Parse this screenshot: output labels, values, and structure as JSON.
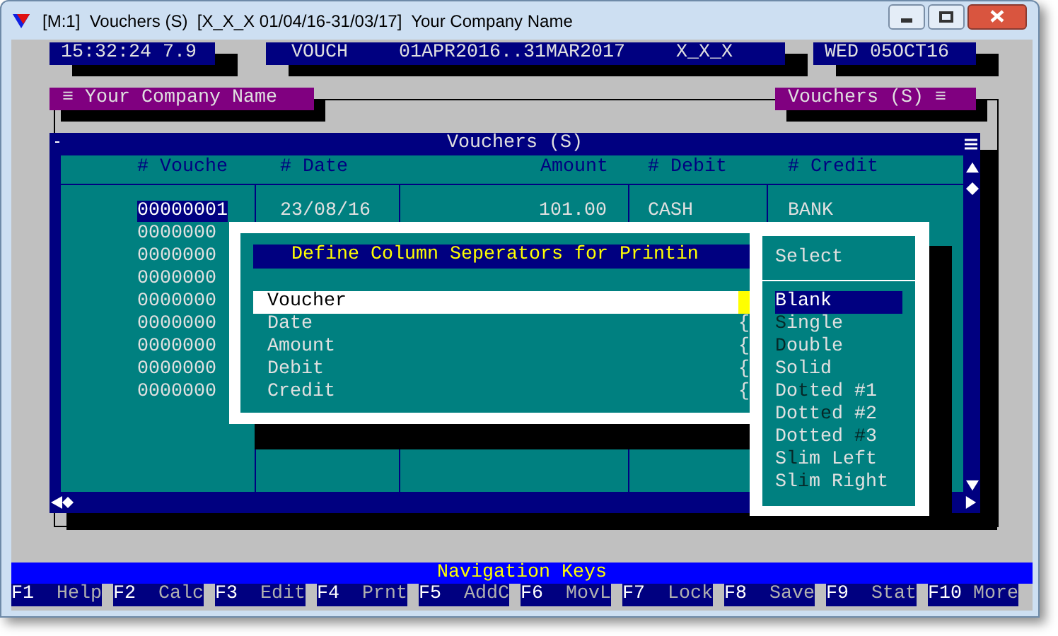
{
  "window": {
    "title": "[M:1]  Vouchers (S)  [X_X_X 01/04/16-31/03/17]  Your Company Name"
  },
  "status_boxes": [
    [
      "15:32:24 7.9"
    ],
    [
      "VOUCH",
      "01APR2016..31MAR2017",
      "X_X_X"
    ],
    [
      "WED 05OCT16"
    ]
  ],
  "panel_tabs": [
    "≡ Your Company Name",
    "Vouchers (S) ≡"
  ],
  "table": {
    "title": "Vouchers (S)",
    "columns": [
      "# Vouche",
      "# Date",
      "Amount",
      "# Debit",
      "# Credit"
    ],
    "rows": [
      {
        "cells": [
          "00000001",
          "23/08/16",
          "101.00",
          "CASH",
          "BANK"
        ],
        "selected": true
      },
      {
        "cells": [
          "0000000"
        ],
        "selected": false
      },
      {
        "cells": [
          "0000000"
        ],
        "selected": false
      },
      {
        "cells": [
          "0000000"
        ],
        "selected": false
      },
      {
        "cells": [
          "0000000"
        ],
        "selected": false
      },
      {
        "cells": [
          "0000000"
        ],
        "selected": false
      },
      {
        "cells": [
          "0000000"
        ],
        "selected": false
      },
      {
        "cells": [
          "0000000"
        ],
        "selected": false
      },
      {
        "cells": [
          "0000000"
        ],
        "selected": false
      }
    ]
  },
  "separator_dialog": {
    "title": "Define Column Seperators for Printin",
    "items": [
      {
        "label": "Voucher",
        "selected": true
      },
      {
        "label": "Date",
        "selected": false,
        "value": "{"
      },
      {
        "label": "Amount",
        "selected": false,
        "value": "{"
      },
      {
        "label": "Debit",
        "selected": false,
        "value": "{"
      },
      {
        "label": "Credit",
        "selected": false,
        "value": "{"
      }
    ]
  },
  "select_dialog": {
    "title": "Select",
    "options": [
      {
        "pre": "Blank",
        "selected": true
      },
      {
        "key": "S",
        "post": "ingle",
        "selected": false
      },
      {
        "key": "D",
        "post": "ouble",
        "selected": false
      },
      {
        "pre": "Solid",
        "selected": false
      },
      {
        "pre": "Do",
        "key": "t",
        "post": "ted #1",
        "selected": false
      },
      {
        "pre": "Dott",
        "key": "e",
        "post": "d #2",
        "selected": false
      },
      {
        "pre": "Dotted ",
        "key": "#",
        "post": "3",
        "selected": false
      },
      {
        "pre": "S",
        "key": "l",
        "post": "im Left",
        "selected": false
      },
      {
        "pre": "Sl",
        "key": "i",
        "post": "m Right",
        "selected": false
      }
    ]
  },
  "navigation": {
    "title": "Navigation Keys",
    "keys": [
      {
        "key": "F1",
        "label": "Help"
      },
      {
        "key": "F2",
        "label": "Calc"
      },
      {
        "key": "F3",
        "label": "Edit"
      },
      {
        "key": "F4",
        "label": "Prnt"
      },
      {
        "key": "F5",
        "label": "AddC"
      },
      {
        "key": "F6",
        "label": "MovL"
      },
      {
        "key": "F7",
        "label": "Lock"
      },
      {
        "key": "F8",
        "label": "Save"
      },
      {
        "key": "F9",
        "label": "Stat"
      },
      {
        "key": "F10",
        "label": "More"
      }
    ]
  }
}
